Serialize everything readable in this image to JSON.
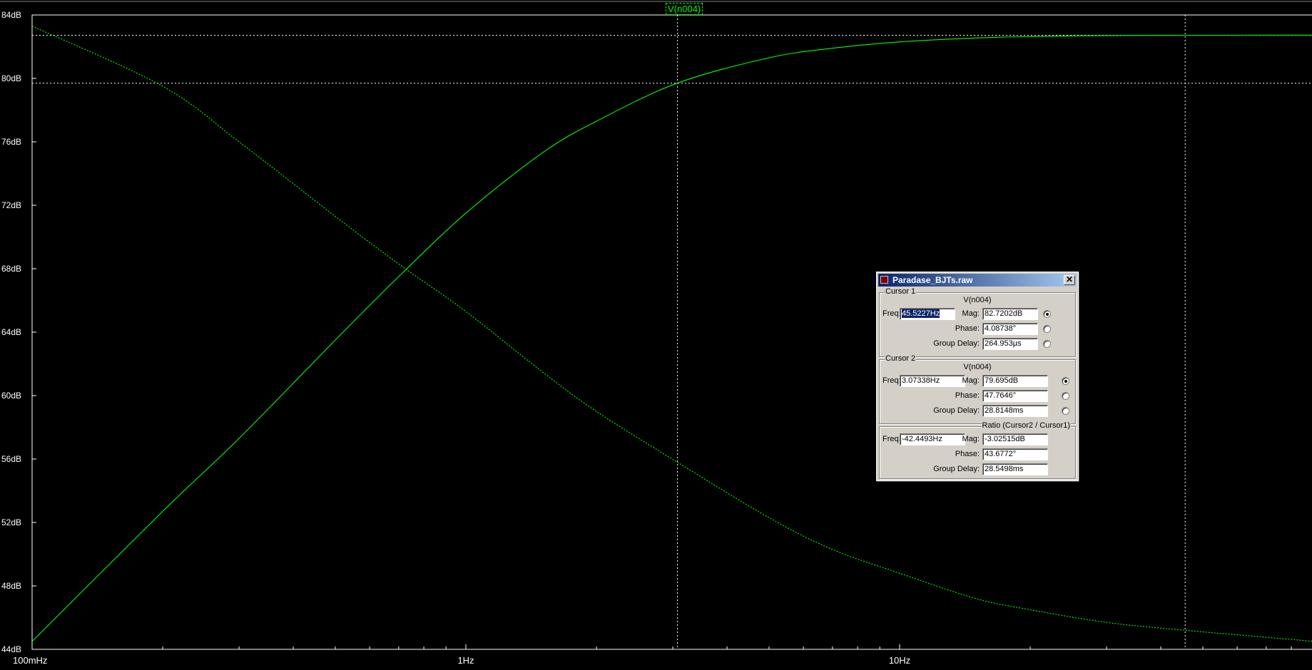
{
  "plot": {
    "trace_name": "V(n004)",
    "y_ticks": [
      "84dB",
      "80dB",
      "76dB",
      "72dB",
      "68dB",
      "64dB",
      "60dB",
      "56dB",
      "52dB",
      "48dB",
      "44dB"
    ],
    "x_ticks": [
      "100mHz",
      "1Hz",
      "10Hz"
    ],
    "colors": {
      "background": "#000000",
      "trace": "#00ff00",
      "grid": "#ffffff"
    }
  },
  "chart_data": {
    "type": "line",
    "x_scale": "log",
    "xlim": [
      "100mHz",
      "~100Hz"
    ],
    "ylim": [
      44,
      84
    ],
    "y_unit": "dB",
    "grid": false,
    "series": [
      {
        "name": "V(n004)",
        "kind": "magnitude (solid)",
        "x_hz": [
          0.1,
          0.2,
          0.3,
          0.5,
          0.7,
          1,
          1.5,
          2,
          3.073,
          5,
          7,
          10,
          15,
          20,
          30,
          45.52,
          100
        ],
        "y_db": [
          44.5,
          52.7,
          57.3,
          63.5,
          67.5,
          71.5,
          75.3,
          77.3,
          79.7,
          81.3,
          81.9,
          82.3,
          82.55,
          82.64,
          82.7,
          82.72,
          82.73
        ]
      },
      {
        "name": "V(n004)",
        "kind": "phase (dotted)",
        "x_hz": [
          0.1,
          0.2,
          0.3,
          0.5,
          0.7,
          1,
          1.5,
          2,
          3.073,
          5,
          7,
          10,
          15,
          20,
          30,
          45.52,
          100
        ],
        "y_db": [
          83.3,
          79.5,
          76.0,
          71.3,
          68.3,
          65.3,
          61.5,
          59.0,
          55.8,
          52.3,
          50.3,
          48.8,
          47.2,
          46.5,
          45.7,
          45.2,
          44.4
        ]
      }
    ],
    "cursors": [
      {
        "freq": "45.5227Hz",
        "mag": "82.7202dB"
      },
      {
        "freq": "3.07338Hz",
        "mag": "79.695dB"
      }
    ]
  },
  "dialog": {
    "title": "Paradase_BJTs.raw",
    "close_label": "✕",
    "cursor1": {
      "title": "Cursor 1",
      "node": "V(n004)",
      "freq_label": "Freq:",
      "freq_value": "45.5227Hz",
      "mag_label": "Mag:",
      "mag_value": "82.7202dB",
      "phase_label": "Phase:",
      "phase_value": "4.08738°",
      "gd_label": "Group Delay:",
      "gd_value": "264.953µs"
    },
    "cursor2": {
      "title": "Cursor 2",
      "node": "V(n004)",
      "freq_label": "Freq:",
      "freq_value": "3.07338Hz",
      "mag_label": "Mag:",
      "mag_value": "79.695dB",
      "phase_label": "Phase:",
      "phase_value": "47.7646°",
      "gd_label": "Group Delay:",
      "gd_value": "28.8148ms"
    },
    "ratio": {
      "title": "Ratio (Cursor2 / Cursor1)",
      "freq_label": "Freq:",
      "freq_value": "-42.4493Hz",
      "mag_label": "Mag:",
      "mag_value": "-3.02515dB",
      "phase_label": "Phase:",
      "phase_value": "43.6772°",
      "gd_label": "Group Delay:",
      "gd_value": "28.5498ms"
    }
  }
}
